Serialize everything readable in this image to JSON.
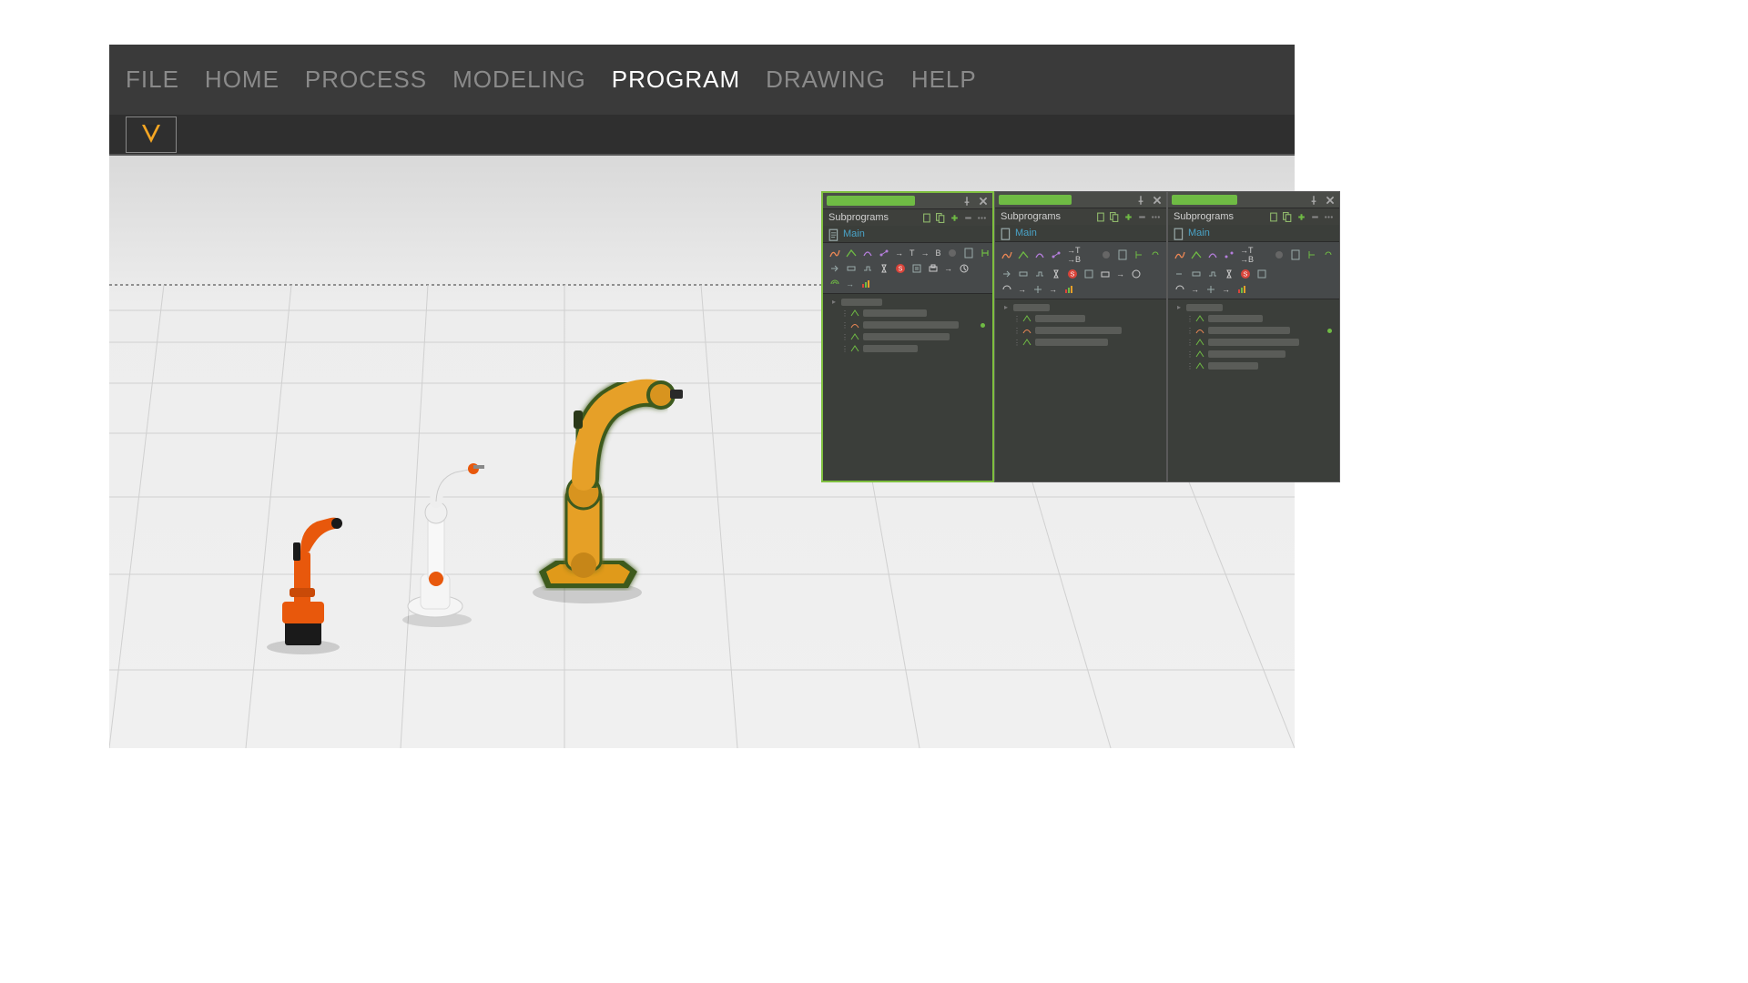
{
  "menu": {
    "items": [
      "FILE",
      "HOME",
      "PROCESS",
      "MODELING",
      "PROGRAM",
      "DRAWING",
      "HELP"
    ],
    "active": "PROGRAM"
  },
  "panels": [
    {
      "section_label": "Subprograms",
      "main_label": "Main",
      "tab_color": "#6fbb44",
      "active": true
    },
    {
      "section_label": "Subprograms",
      "main_label": "Main",
      "tab_color": "#6fbb44",
      "active": false
    },
    {
      "section_label": "Subprograms",
      "main_label": "Main",
      "tab_color": "#6fbb44",
      "active": false
    }
  ],
  "toolbar_text": {
    "t": "T",
    "b": "B"
  },
  "colors": {
    "accent_green": "#6fbb44",
    "logo_orange": "#f5a623",
    "link": "#4aa3c7"
  }
}
